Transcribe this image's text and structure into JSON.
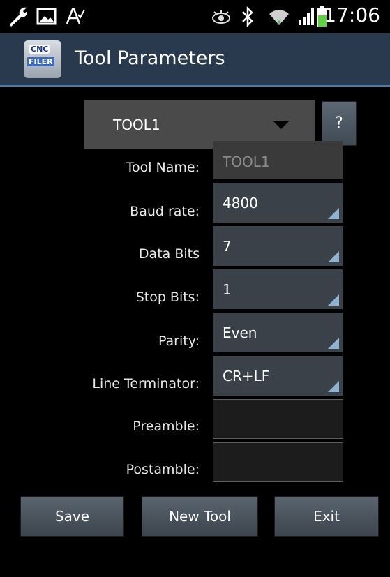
{
  "status_bar": {
    "time": "17:06",
    "icons": [
      "wrench-icon",
      "image-icon",
      "spellcheck-icon",
      "eye-icon",
      "bluetooth-icon",
      "wifi-icon",
      "signal-icon",
      "battery-icon"
    ],
    "battery_color": "#5dd13f"
  },
  "action_bar": {
    "title": "Tool Parameters",
    "app_icon_text_top": "CNC",
    "app_icon_text_bottom": "FILER"
  },
  "tool_selector": {
    "value": "TOOL1"
  },
  "help_button": {
    "label": "?"
  },
  "form": {
    "tool_name": {
      "label": "Tool Name:",
      "value": "TOOL1"
    },
    "baud_rate": {
      "label": "Baud rate:",
      "value": "4800"
    },
    "data_bits": {
      "label": "Data Bits",
      "value": "7"
    },
    "stop_bits": {
      "label": "Stop Bits:",
      "value": "1"
    },
    "parity": {
      "label": "Parity:",
      "value": "Even"
    },
    "line_terminator": {
      "label": "Line Terminator:",
      "value": "CR+LF"
    },
    "preamble": {
      "label": "Preamble:",
      "value": ""
    },
    "postamble": {
      "label": "Postamble:",
      "value": ""
    }
  },
  "buttons": {
    "save": "Save",
    "new_tool": "New Tool",
    "exit": "Exit"
  },
  "colors": {
    "action_bar": "#2a3a4e",
    "field_bg": "#3a4148",
    "corner_accent": "#8fb2d1"
  }
}
